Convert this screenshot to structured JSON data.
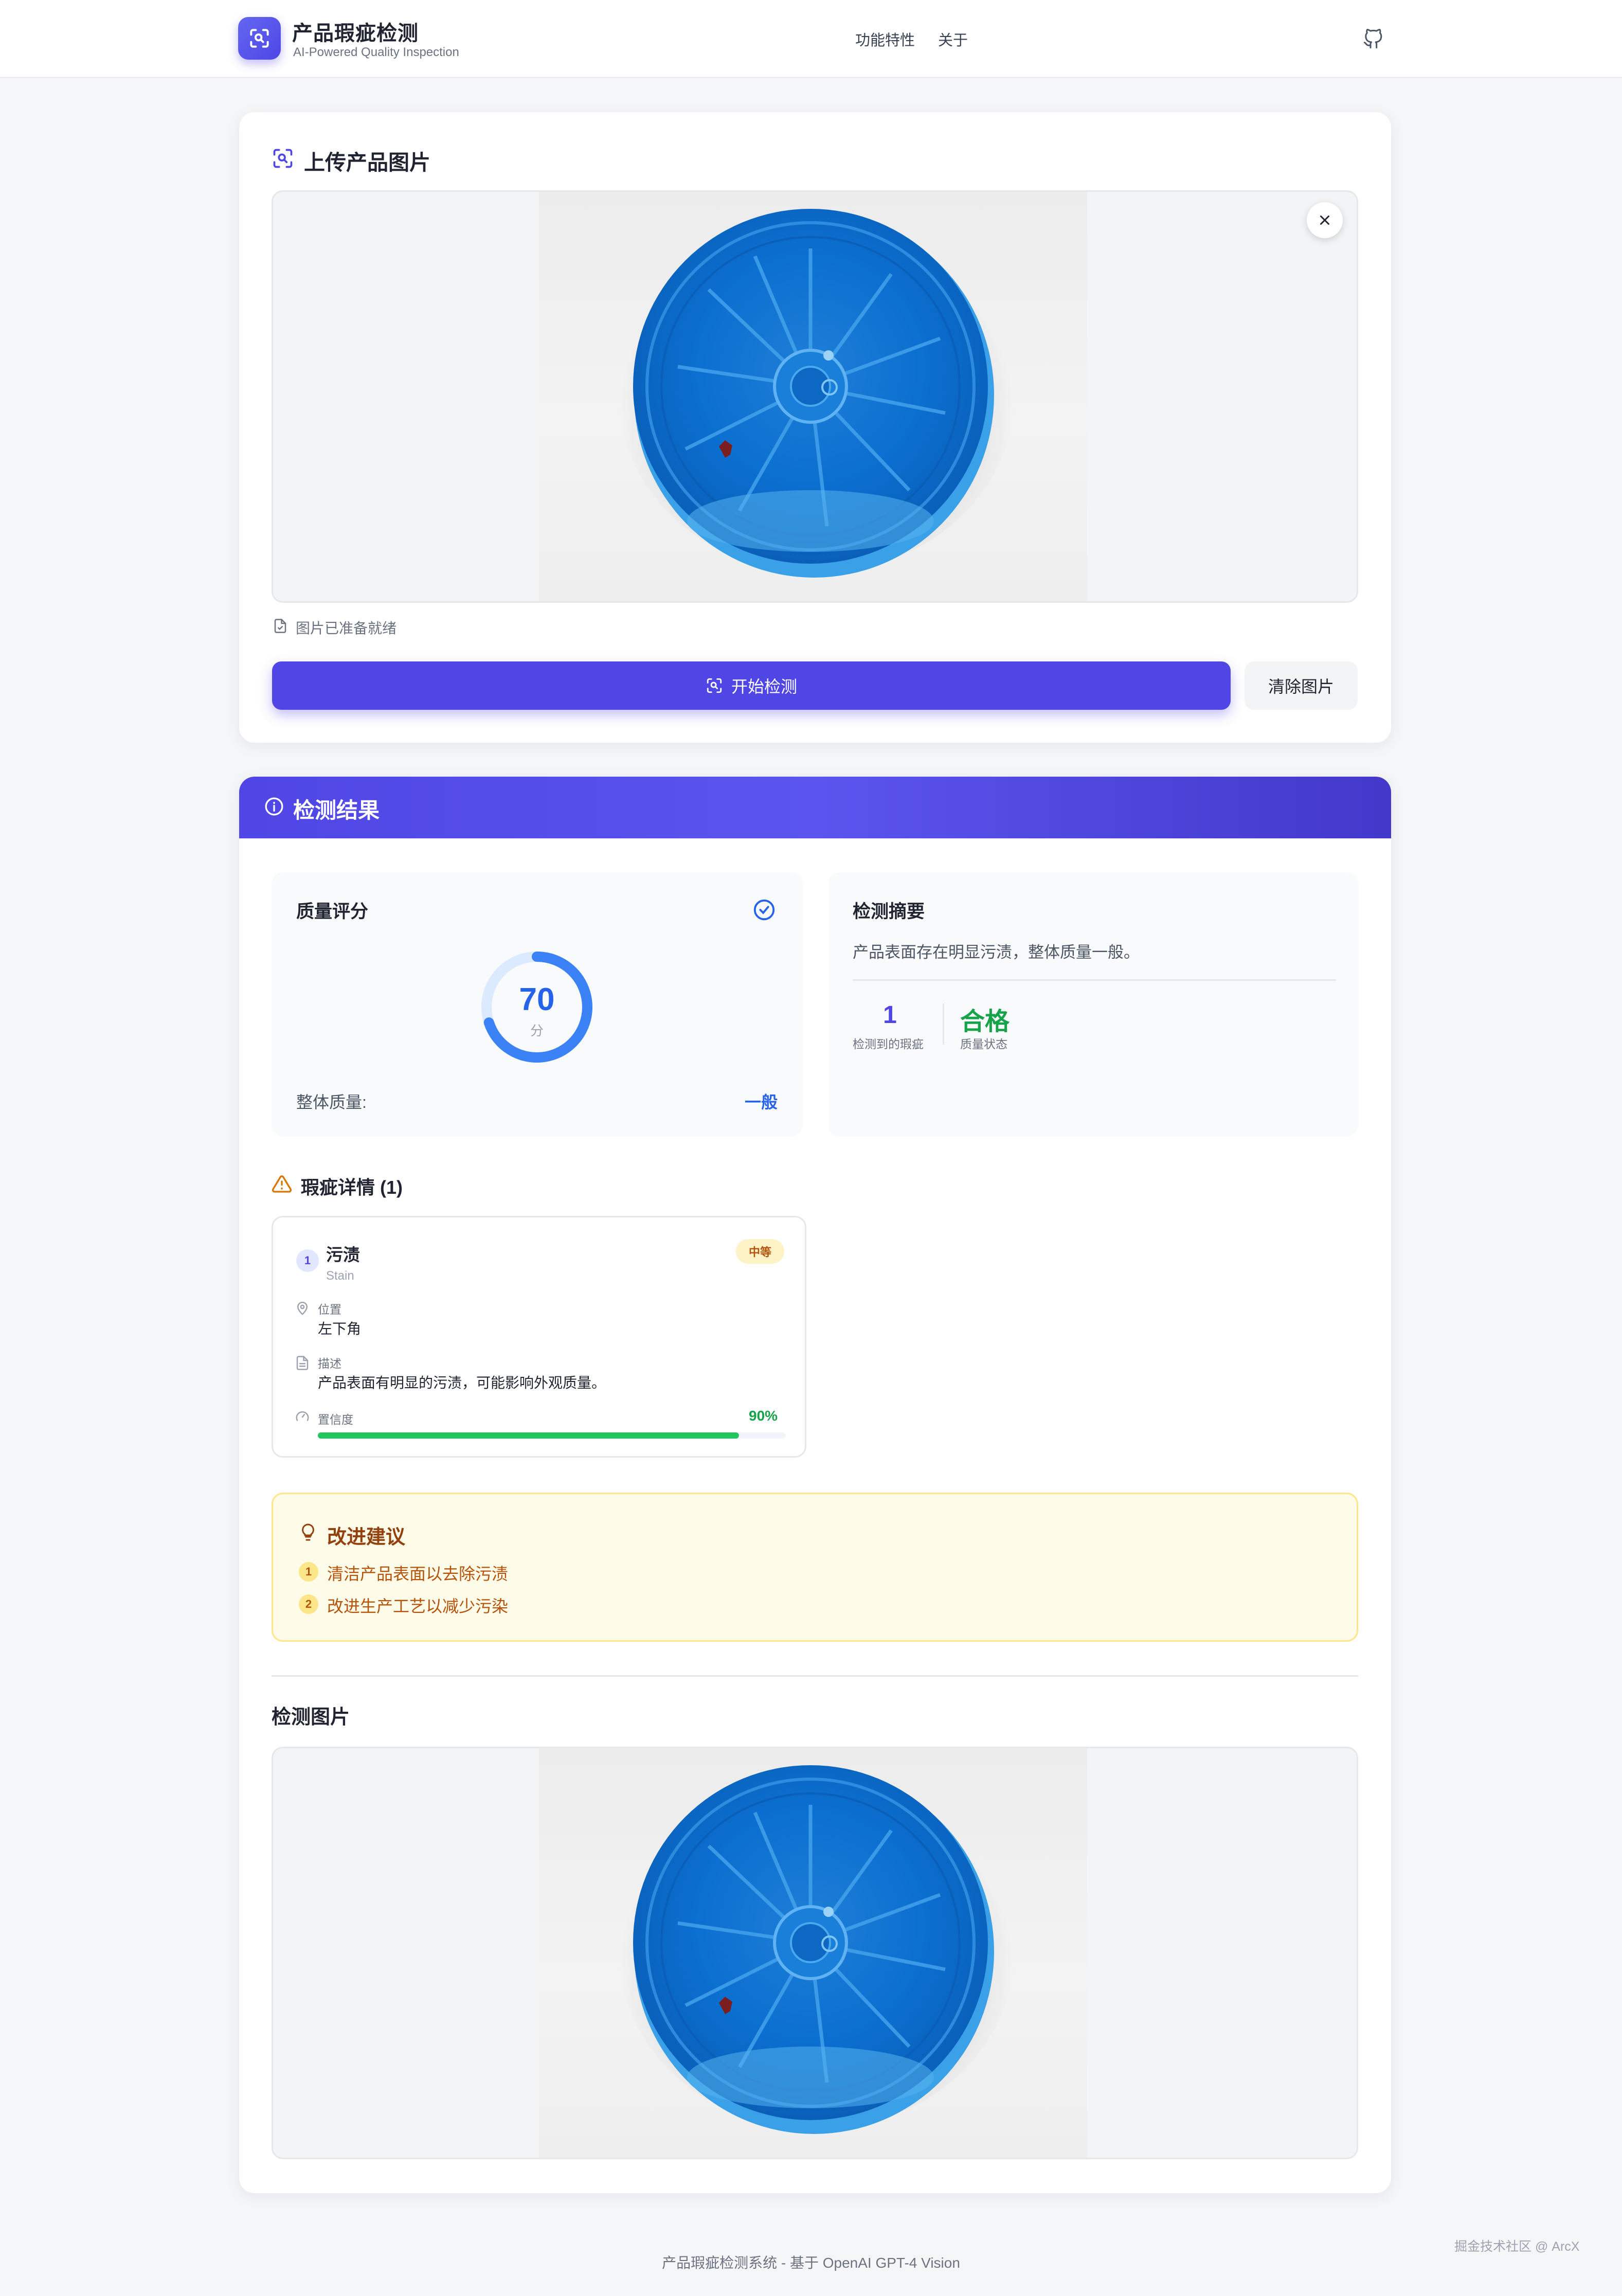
{
  "header": {
    "brand_title": "产品瑕疵检测",
    "brand_subtitle": "AI-Powered Quality Inspection",
    "nav": [
      "功能特性",
      "关于"
    ]
  },
  "upload": {
    "title": "上传产品图片",
    "status": "图片已准备就绪",
    "start_button": "开始检测",
    "clear_button": "清除图片"
  },
  "results": {
    "title": "检测结果",
    "score_panel": {
      "title": "质量评分",
      "score": "70",
      "unit": "分",
      "score_fraction": 0.7,
      "overall_label": "整体质量:",
      "overall_value": "一般"
    },
    "summary_panel": {
      "title": "检测摘要",
      "text": "产品表面存在明显污渍，整体质量一般。",
      "defect_count": "1",
      "defect_count_label": "检测到的瑕疵",
      "quality_status": "合格",
      "quality_status_label": "质量状态"
    },
    "defects_title": "瑕疵详情 (1)",
    "defects": [
      {
        "index": "1",
        "name": "污渍",
        "name_en": "Stain",
        "severity": "中等",
        "location_label": "位置",
        "location": "左下角",
        "description_label": "描述",
        "description": "产品表面有明显的污渍，可能影响外观质量。",
        "confidence_label": "置信度",
        "confidence": "90%",
        "confidence_fraction": 0.9
      }
    ],
    "advice": {
      "title": "改进建议",
      "items": [
        {
          "index": "1",
          "text": "清洁产品表面以去除污渍"
        },
        {
          "index": "2",
          "text": "改进生产工艺以减少污染"
        }
      ]
    },
    "detect_image_title": "检测图片"
  },
  "footer": {
    "text": "产品瑕疵检测系统 - 基于 OpenAI GPT-4 Vision",
    "watermark": "掘金技术社区 @ ArcX"
  },
  "colors": {
    "accent": "#4f46e5",
    "score_blue": "#3b82f6",
    "pass_green": "#16a34a",
    "warning_amber": "#b45309"
  },
  "icons": [
    "scan-icon",
    "github-icon",
    "close-icon",
    "file-check-icon",
    "info-icon",
    "check-circle-icon",
    "alert-triangle-icon",
    "map-pin-icon",
    "file-text-icon",
    "gauge-icon",
    "lightbulb-icon"
  ]
}
